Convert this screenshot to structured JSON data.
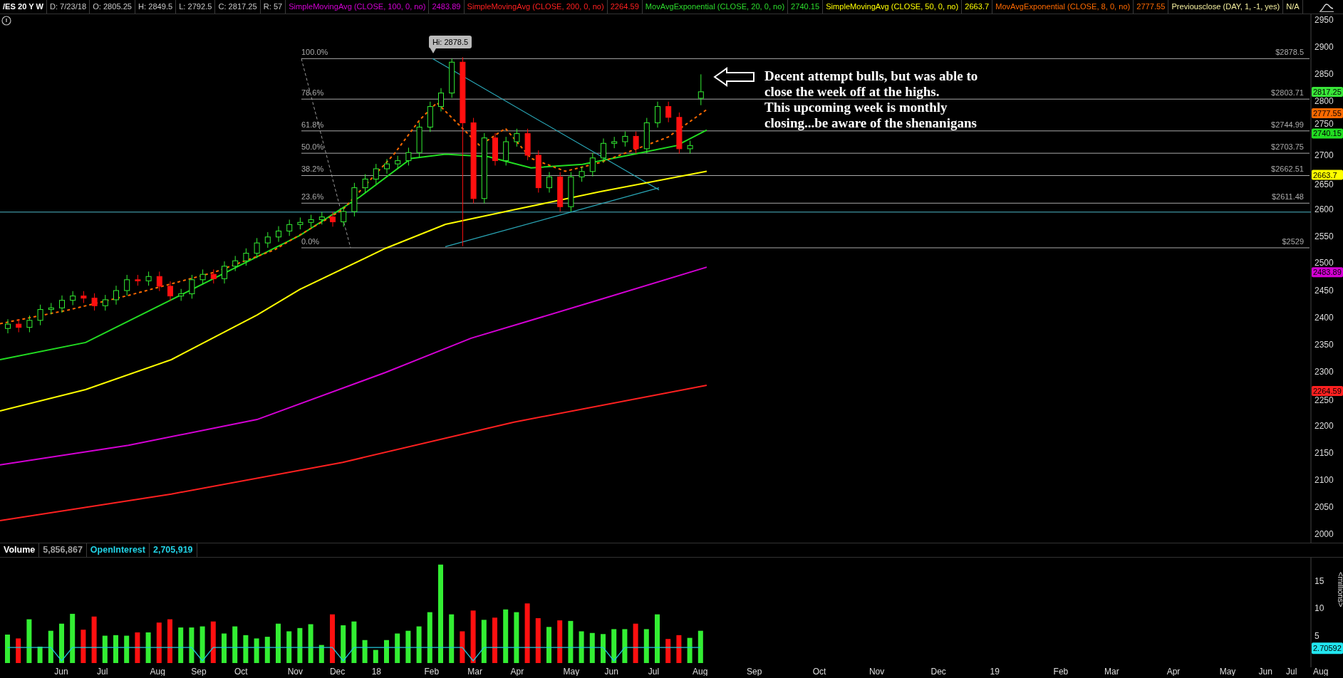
{
  "header": [
    {
      "text": "/ES 20 Y W",
      "color": "#ffffff"
    },
    {
      "text": "D: 7/23/18",
      "color": "#c8c8c8"
    },
    {
      "text": "O: 2805.25",
      "color": "#c8c8c8"
    },
    {
      "text": "H: 2849.5",
      "color": "#c8c8c8"
    },
    {
      "text": "L: 2792.5",
      "color": "#c8c8c8"
    },
    {
      "text": "C: 2817.25",
      "color": "#c8c8c8"
    },
    {
      "text": "R: 57",
      "color": "#c8c8c8"
    },
    {
      "text": "SimpleMovingAvg (CLOSE, 100, 0, no)",
      "color": "#d400d4"
    },
    {
      "text": "2483.89",
      "color": "#d400d4"
    },
    {
      "text": "SimpleMovingAvg (CLOSE, 200, 0, no)",
      "color": "#ff2020"
    },
    {
      "text": "2264.59",
      "color": "#ff2020"
    },
    {
      "text": "MovAvgExponential (CLOSE, 20, 0, no)",
      "color": "#2ddc2d"
    },
    {
      "text": "2740.15",
      "color": "#2ddc2d"
    },
    {
      "text": "SimpleMovingAvg (CLOSE, 50, 0, no)",
      "color": "#ffff00"
    },
    {
      "text": "2663.7",
      "color": "#ffff00"
    },
    {
      "text": "MovAvgExponential (CLOSE, 8, 0, no)",
      "color": "#ff6a00"
    },
    {
      "text": "2777.55",
      "color": "#ff6a00"
    },
    {
      "text": "Previousclose (DAY, 1, -1, yes)",
      "color": "#f5f0a0"
    },
    {
      "text": "N/A",
      "color": "#f5f0a0"
    }
  ],
  "price_chart": {
    "high_label": "Hi: 2878.5",
    "fib_levels": [
      {
        "percent": "100.0%",
        "price": "$2878.5"
      },
      {
        "percent": "78.6%",
        "price": "$2803.71"
      },
      {
        "percent": "61.8%",
        "price": "$2744.99"
      },
      {
        "percent": "50.0%",
        "price": "$2703.75"
      },
      {
        "percent": "38.2%",
        "price": "$2662.51"
      },
      {
        "percent": "23.6%",
        "price": "$2611.48"
      },
      {
        "percent": "0.0%",
        "price": "$2529"
      }
    ],
    "annotation": "Decent attempt bulls, but was able to close the week off at the highs.\nThis upcoming week is monthly closing...be aware of the shenanigans",
    "y_axis": [
      "2950",
      "2900",
      "2850",
      "2800",
      "2750",
      "2700",
      "2650",
      "2600",
      "2550",
      "2500",
      "2450",
      "2400",
      "2350",
      "2300",
      "2250",
      "2200",
      "2150",
      "2100",
      "2050",
      "2000"
    ],
    "price_tags": [
      {
        "text": "2817.25",
        "color": "#39e639"
      },
      {
        "text": "2777.55",
        "color": "#ff6a00"
      },
      {
        "text": "2740.15",
        "color": "#22dd22"
      },
      {
        "text": "2663.7",
        "color": "#ffff00"
      },
      {
        "text": "2483.89",
        "color": "#d400d4"
      },
      {
        "text": "2264.59",
        "color": "#ff2020"
      }
    ]
  },
  "time_axis": [
    "Jun",
    "Jul",
    "Aug",
    "Sep",
    "Oct",
    "Nov",
    "Dec",
    "18",
    "Feb",
    "Mar",
    "Apr",
    "May",
    "Jun",
    "Jul",
    "Aug",
    "Sep",
    "Oct",
    "Nov",
    "Dec",
    "19",
    "Feb",
    "Mar",
    "Apr",
    "May",
    "Jun",
    "Jul",
    "Aug"
  ],
  "volume_panel": {
    "legend": [
      {
        "text": "Volume",
        "color": "#ffffff"
      },
      {
        "text": "5,856,867",
        "color": "#a0a0a0"
      },
      {
        "text": "OpenInterest",
        "color": "#22d3e6"
      },
      {
        "text": "2,705,919",
        "color": "#22d3e6"
      }
    ],
    "unit_label": "<millions>",
    "oi_tag": "2.70592",
    "y_axis": [
      "15",
      "10",
      "5"
    ]
  }
}
